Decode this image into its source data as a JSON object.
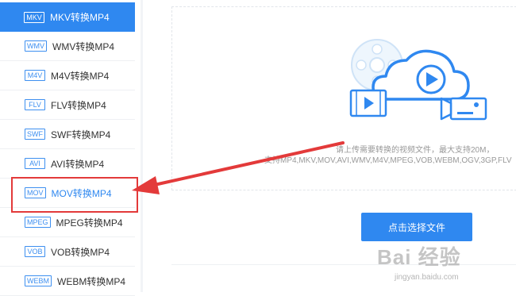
{
  "sidebar": {
    "items": [
      {
        "badge": "MKV",
        "label": "MKV转换MP4",
        "state": "active"
      },
      {
        "badge": "WMV",
        "label": "WMV转换MP4",
        "state": "normal"
      },
      {
        "badge": "M4V",
        "label": "M4V转换MP4",
        "state": "normal"
      },
      {
        "badge": "FLV",
        "label": "FLV转换MP4",
        "state": "normal"
      },
      {
        "badge": "SWF",
        "label": "SWF转换MP4",
        "state": "normal"
      },
      {
        "badge": "AVI",
        "label": "AVI转换MP4",
        "state": "normal"
      },
      {
        "badge": "MOV",
        "label": "MOV转换MP4",
        "state": "selected"
      },
      {
        "badge": "MPEG",
        "label": "MPEG转换MP4",
        "state": "normal"
      },
      {
        "badge": "VOB",
        "label": "VOB转换MP4",
        "state": "normal"
      },
      {
        "badge": "WEBM",
        "label": "WEBM转换MP4",
        "state": "normal"
      }
    ]
  },
  "upload": {
    "hint_line1": "请上传需要转换的视频文件，最大支持20M，",
    "hint_line2": "支持MP4,MKV,MOV,AVI,WMV,M4V,MPEG,VOB,WEBM,OGV,3GP,FLV",
    "button_label": "点击选择文件"
  },
  "watermark": {
    "brand": "Bai 经验",
    "url": "jingyan.baidu.com"
  },
  "colors": {
    "accent": "#2f88f0",
    "annotation": "#e33a3a"
  }
}
